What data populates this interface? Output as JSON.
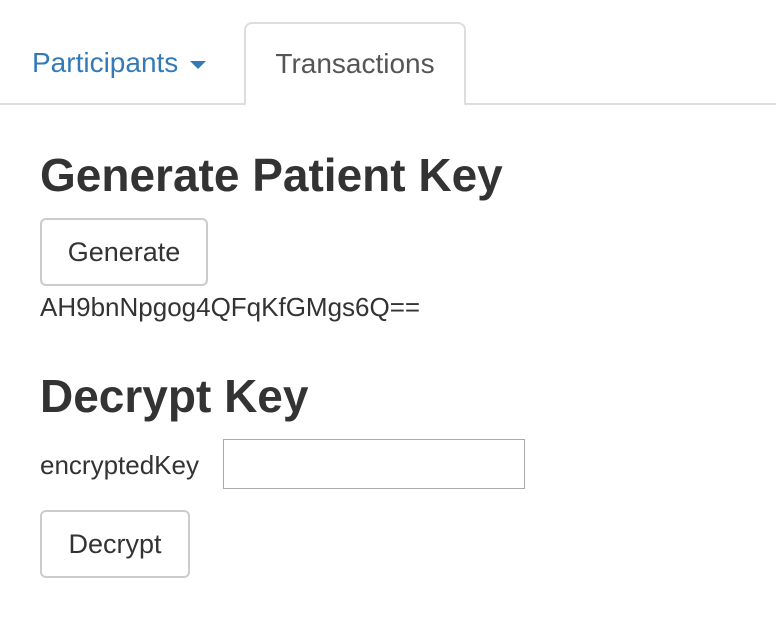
{
  "tabs": {
    "participants_label": "Participants",
    "transactions_label": "Transactions",
    "active": "Transactions"
  },
  "generate_section": {
    "title": "Generate Patient Key",
    "button_label": "Generate",
    "generated_key": "AH9bnNpgog4QFqKfGMgs6Q=="
  },
  "decrypt_section": {
    "title": "Decrypt Key",
    "field_label": "encryptedKey",
    "field_value": "",
    "button_label": "Decrypt"
  },
  "colors": {
    "link": "#337ab7",
    "text": "#333333",
    "border": "#dddddd"
  },
  "icons": {
    "participants_dropdown": "caret-down-icon"
  }
}
